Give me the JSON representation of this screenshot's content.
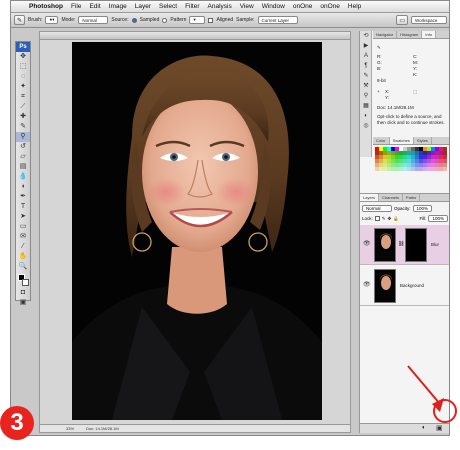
{
  "menu": {
    "apple": "",
    "app": "Photoshop",
    "items": [
      "File",
      "Edit",
      "Image",
      "Layer",
      "Select",
      "Filter",
      "Analysis",
      "View",
      "Window",
      "onOne",
      "onOne",
      "Help"
    ]
  },
  "options": {
    "brush_label": "Brush:",
    "mode_label": "Mode:",
    "mode_value": "Normal",
    "source_label": "Source:",
    "sampled": "Sampled",
    "pattern": "Pattern",
    "aligned": "Aligned",
    "sample_label": "Sample:",
    "sample_value": "Current Layer",
    "workspace": "Workspace"
  },
  "toolbox": {
    "logo": "Ps"
  },
  "document": {
    "status": [
      "33%",
      "Doc: 14.1M/28.1M"
    ]
  },
  "dock": {
    "top_tabs": [
      "Navigator",
      "Histogram",
      "Info"
    ],
    "info": {
      "r": "R:",
      "g": "G:",
      "b": "B:",
      "c": "C:",
      "m": "M:",
      "y": "Y:",
      "k": "K:",
      "x": "X:",
      "yy": "Y:",
      "bits": "8-bit",
      "doc": "Doc: 14.1M/28.1M",
      "hint": "Opt-click to define a source, and then click and to continue strokes."
    },
    "swatch_tabs": [
      "Color",
      "Swatches",
      "Styles"
    ],
    "layers_tabs": [
      "Layers",
      "Channels",
      "Paths"
    ],
    "blend": "Normal",
    "opacity_label": "Opacity:",
    "opacity": "100%",
    "lock_label": "Lock:",
    "fill_label": "Fill:",
    "fill": "100%",
    "layers": [
      "Blur",
      "Background"
    ]
  },
  "overlay": {
    "step": "3"
  },
  "colors": {
    "accent": "#e9241f",
    "selected_layer": "#e9cfe3"
  }
}
